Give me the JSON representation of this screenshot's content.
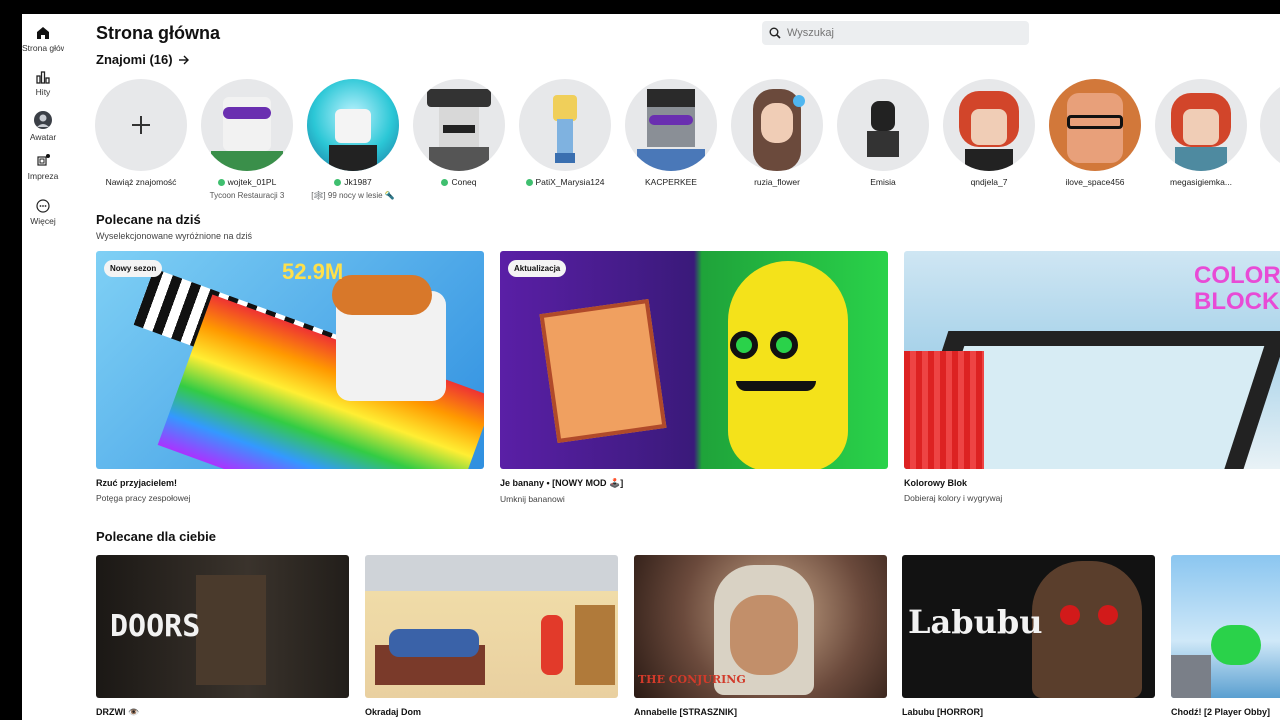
{
  "sidebar": {
    "items": [
      {
        "label": "Strona główna",
        "icon": "home-icon"
      },
      {
        "label": "Hity",
        "icon": "charts-icon"
      },
      {
        "label": "Awatar",
        "icon": "avatar-icon"
      },
      {
        "label": "Impreza",
        "icon": "party-icon"
      },
      {
        "label": "Więcej",
        "icon": "more-icon"
      }
    ]
  },
  "header": {
    "title": "Strona główna",
    "search_placeholder": "Wyszukaj"
  },
  "friends": {
    "heading": "Znajomi (16)",
    "items": [
      {
        "name": "Nawiąż znajomość",
        "online": false,
        "status": "",
        "color": "#e7e8ea"
      },
      {
        "name": "wojtek_01PL",
        "online": true,
        "status": "Tycoon Restauracji 3",
        "color": "#c9d8b4"
      },
      {
        "name": "Jk1987",
        "online": true,
        "status": "[🕸️] 99 nocy w lesie 🔦",
        "color": "#2bc7d6"
      },
      {
        "name": "Coneq",
        "online": true,
        "status": "",
        "color": "#9a9a9a"
      },
      {
        "name": "PatiX_Marysia124",
        "online": true,
        "status": "",
        "color": "#e7e8ea"
      },
      {
        "name": "KACPERKEE",
        "online": false,
        "status": "",
        "color": "#4a4f56"
      },
      {
        "name": "ruzia_flower",
        "online": false,
        "status": "",
        "color": "#d8b9a4"
      },
      {
        "name": "Emisia",
        "online": false,
        "status": "",
        "color": "#e7e8ea"
      },
      {
        "name": "qndjela_7",
        "online": false,
        "status": "",
        "color": "#e0e0e0"
      },
      {
        "name": "ilove_space456",
        "online": false,
        "status": "",
        "color": "#c56a3a"
      },
      {
        "name": "megasigiemka...",
        "online": false,
        "status": "",
        "color": "#e7e8ea"
      }
    ]
  },
  "featured": {
    "heading": "Polecane na dziś",
    "subheading": "Wyselekcjonowane wyróżnione na dziś",
    "items": [
      {
        "badge": "Nowy sezon",
        "title": "Rzuć przyjacielem!",
        "subtitle": "Potęga pracy zespołowej",
        "color": "#3aa8e6",
        "overlay": "52.9M"
      },
      {
        "badge": "Aktualizacja",
        "title": "Je banany • [NOWY MOD 🕹️]",
        "subtitle": "Umknij bananowi",
        "color": "#6a2bb0",
        "overlay": ""
      },
      {
        "badge": "",
        "title": "Kolorowy Blok",
        "subtitle": "Dobieraj kolory i wygrywaj",
        "color": "#a9d3ea",
        "overlay": "COLOR BLOCK"
      }
    ]
  },
  "recommended": {
    "heading": "Polecane dla ciebie",
    "items": [
      {
        "title": "DRZWI 👁️",
        "color": "#2a2622",
        "overlay": "DOORS"
      },
      {
        "title": "Okradaj Dom",
        "color": "#e9d8a8",
        "overlay": ""
      },
      {
        "title": "Annabelle [STRASZNIK]",
        "color": "#6b4a3c",
        "overlay": "THE CONJURING"
      },
      {
        "title": "Labubu [HORROR]",
        "color": "#121212",
        "overlay": "Labubu"
      },
      {
        "title": "Chodź! [2 Player Obby]",
        "color": "#8bc6f0",
        "overlay": ""
      }
    ]
  },
  "colors": {
    "accent": "#3fbf6f",
    "search_bg": "#eceef0",
    "avatar_bg": "#e7e8ea"
  }
}
